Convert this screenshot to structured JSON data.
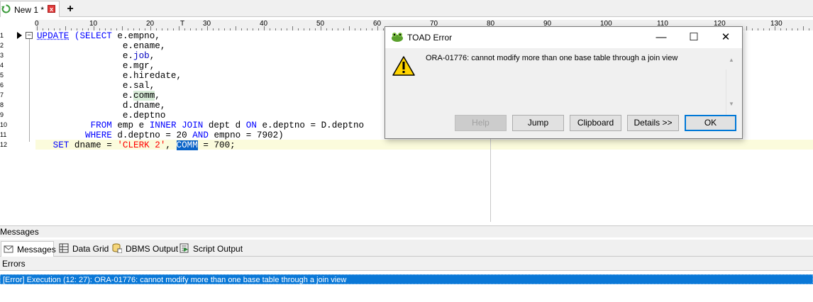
{
  "tabs": {
    "doc_title": "New 1 *",
    "close_glyph": "x",
    "add_glyph": "+"
  },
  "ruler": {
    "labels": [
      "0",
      "10",
      "20",
      "30",
      "40",
      "50",
      "60",
      "70",
      "80",
      "90",
      "100",
      "110",
      "120",
      "130"
    ],
    "caret": "T"
  },
  "editor": {
    "line_numbers": [
      "1",
      "2",
      "3",
      "4",
      "5",
      "6",
      "7",
      "8",
      "9",
      "10",
      "11",
      "12"
    ],
    "lines": [
      [
        {
          "t": "UPDATE",
          "c": "kw u-dot"
        },
        {
          "t": " (SELECT ",
          "c": "kw"
        },
        {
          "t": "e.empno,",
          "c": "ident"
        }
      ],
      [
        {
          "t": "                e.ename,",
          "c": "ident"
        }
      ],
      [
        {
          "t": "                e.",
          "c": "ident"
        },
        {
          "t": "job",
          "c": "fld"
        },
        {
          "t": ",",
          "c": "ident"
        }
      ],
      [
        {
          "t": "                e.mgr,",
          "c": "ident"
        }
      ],
      [
        {
          "t": "                e.hiredate,",
          "c": "ident"
        }
      ],
      [
        {
          "t": "                e.sal,",
          "c": "ident"
        }
      ],
      [
        {
          "t": "                e.",
          "c": "ident"
        },
        {
          "t": "comm",
          "c": "ident hl-green"
        },
        {
          "t": ",",
          "c": "ident"
        }
      ],
      [
        {
          "t": "                d.dname,",
          "c": "ident"
        }
      ],
      [
        {
          "t": "                e.deptno",
          "c": "ident"
        }
      ],
      [
        {
          "t": "          FROM ",
          "c": "kw"
        },
        {
          "t": "emp e ",
          "c": "ident"
        },
        {
          "t": "INNER JOIN ",
          "c": "kw"
        },
        {
          "t": "dept d ",
          "c": "ident"
        },
        {
          "t": "ON ",
          "c": "kw"
        },
        {
          "t": "e.deptno = D.deptno",
          "c": "ident"
        }
      ],
      [
        {
          "t": "         WHERE ",
          "c": "kw"
        },
        {
          "t": "d.deptno = ",
          "c": "ident"
        },
        {
          "t": "20 ",
          "c": "num"
        },
        {
          "t": "AND ",
          "c": "kw"
        },
        {
          "t": "empno = ",
          "c": "ident"
        },
        {
          "t": "7902",
          "c": "num"
        },
        {
          "t": ")",
          "c": "ident"
        }
      ],
      [
        {
          "t": "   SET ",
          "c": "kw"
        },
        {
          "t": "dname = ",
          "c": "ident"
        },
        {
          "t": "'CLERK 2'",
          "c": "str"
        },
        {
          "t": ", ",
          "c": "ident"
        },
        {
          "t": "COMM",
          "c": "hl-sel"
        },
        {
          "t": " = ",
          "c": "ident"
        },
        {
          "t": "700",
          "c": "num"
        },
        {
          "t": ";",
          "c": "ident"
        }
      ]
    ]
  },
  "dialog": {
    "title": "TOAD Error",
    "minimize": "—",
    "maximize": "☐",
    "close": "✕",
    "message": "ORA-01776: cannot modify more than one base table through a join view",
    "buttons": {
      "help": "Help",
      "jump": "Jump",
      "clipboard": "Clipboard",
      "details": "Details >>",
      "ok": "OK"
    }
  },
  "messages": {
    "header": "Messages",
    "tabs": [
      "Messages",
      "Data Grid",
      "DBMS Output",
      "Script Output"
    ],
    "errors_title": "Errors",
    "error_row": "[Error] Execution (12: 27): ORA-01776: cannot modify more than one base table through a join view"
  },
  "colors": {
    "selection": "#0a78d7",
    "keyword": "#0000ff",
    "string": "#ff0000",
    "current_line": "#fbfbdc"
  }
}
